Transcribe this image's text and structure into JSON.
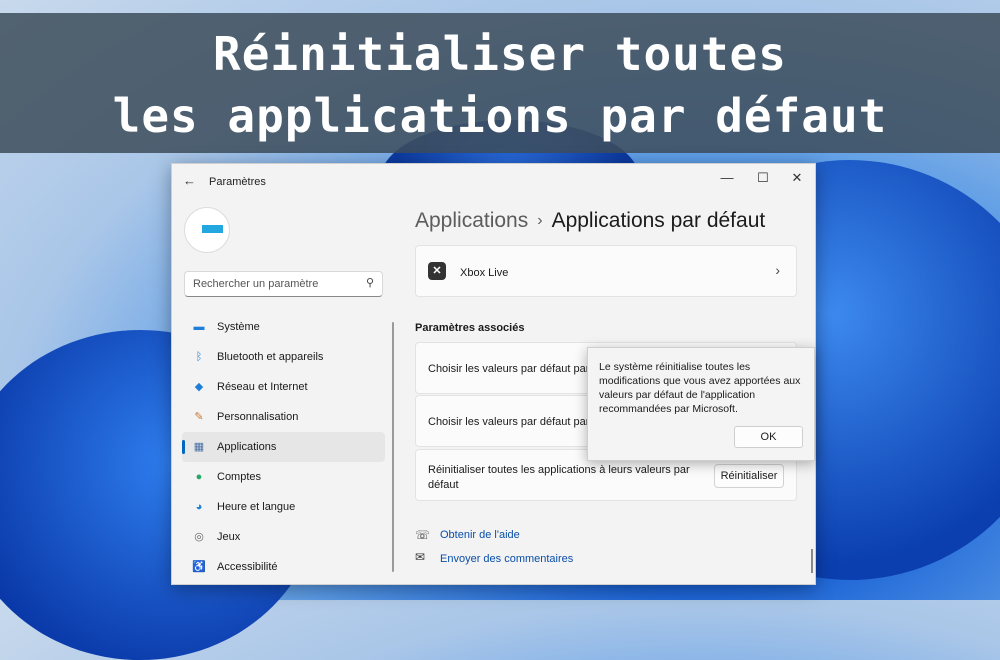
{
  "banner": {
    "line1": "Réinitialiser toutes",
    "line2": "les applications par défaut"
  },
  "window": {
    "title": "Paramètres",
    "controls": {
      "minimize": "—",
      "maximize": "☐",
      "close": "✕"
    }
  },
  "search": {
    "placeholder": "Rechercher un paramètre"
  },
  "sidebar": {
    "items": [
      {
        "label": "Système",
        "icon": "monitor-icon"
      },
      {
        "label": "Bluetooth et appareils",
        "icon": "bluetooth-icon"
      },
      {
        "label": "Réseau et Internet",
        "icon": "wifi-icon"
      },
      {
        "label": "Personnalisation",
        "icon": "brush-icon"
      },
      {
        "label": "Applications",
        "icon": "apps-icon",
        "active": true
      },
      {
        "label": "Comptes",
        "icon": "person-icon"
      },
      {
        "label": "Heure et langue",
        "icon": "globe-clock-icon"
      },
      {
        "label": "Jeux",
        "icon": "gamepad-icon"
      },
      {
        "label": "Accessibilité",
        "icon": "accessibility-icon"
      }
    ]
  },
  "breadcrumb": {
    "parent": "Applications",
    "separator": "›",
    "current": "Applications par défaut"
  },
  "xbox_row": {
    "label": "Xbox Live",
    "icon": "xbox-icon"
  },
  "related": {
    "heading": "Paramètres associés",
    "row1": "Choisir les valeurs par défaut par ty",
    "row2": "Choisir les valeurs par défaut par ty",
    "row3": "Réinitialiser toutes les applications à leurs valeurs par défaut",
    "reset_button": "Réinitialiser"
  },
  "links": {
    "help": "Obtenir de l'aide",
    "feedback": "Envoyer des commentaires"
  },
  "dialog": {
    "message": "Le système réinitialise toutes les modifications que vous avez apportées aux valeurs par défaut de l'application recommandées par Microsoft.",
    "ok": "OK"
  }
}
